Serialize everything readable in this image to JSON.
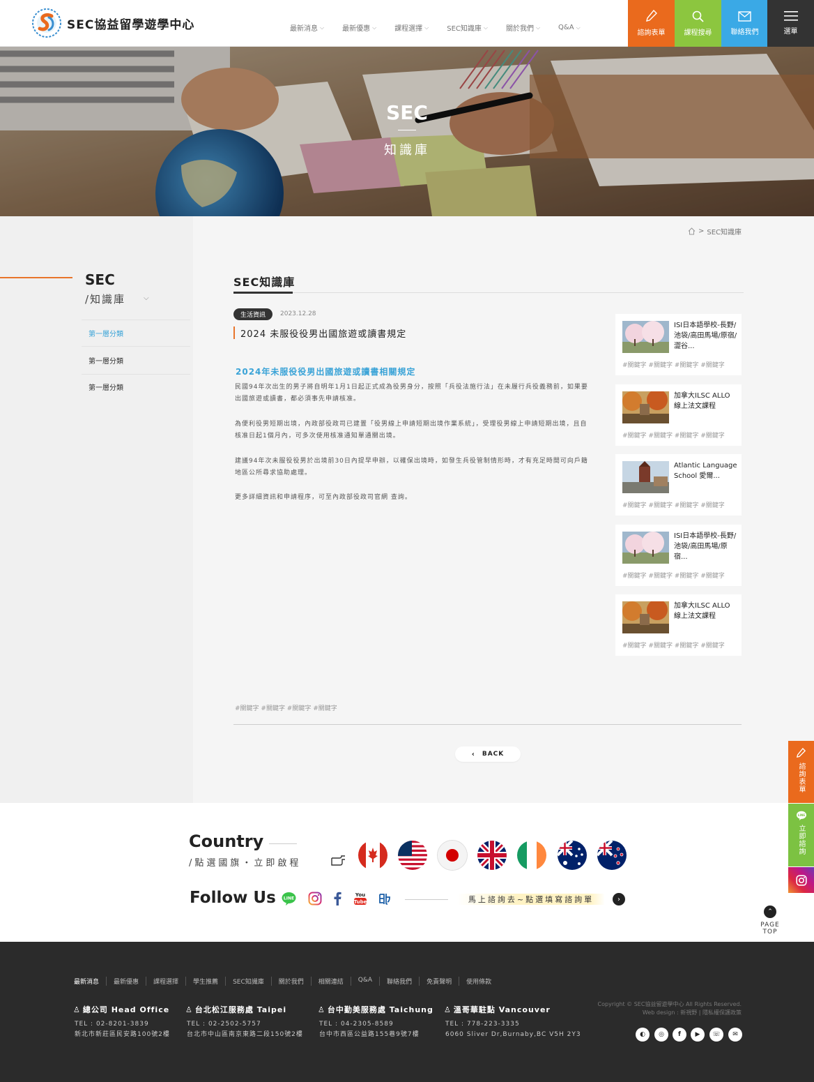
{
  "brand": {
    "name": "SEC協益留學遊學中心"
  },
  "nav": {
    "items": [
      {
        "label": "最新消息"
      },
      {
        "label": "最新優惠"
      },
      {
        "label": "課程選擇"
      },
      {
        "label": "SEC知識庫"
      },
      {
        "label": "關於我們"
      },
      {
        "label": "Q&A"
      }
    ]
  },
  "quick": {
    "inquiry": {
      "label": "諮詢表單",
      "color": "#ea6a1d",
      "icon": "pencil-icon"
    },
    "course": {
      "label": "課程搜尋",
      "color": "#8cc63f",
      "icon": "search-icon"
    },
    "contact": {
      "label": "聯絡我們",
      "color": "#3aa9e6",
      "icon": "mail-icon"
    },
    "menu": {
      "label": "選單",
      "color": "#333333",
      "icon": "hamburger-icon"
    }
  },
  "hero": {
    "title": "SEC",
    "subtitle": "知識庫"
  },
  "breadcrumb": {
    "home_icon": "home-icon",
    "current": "SEC知識庫"
  },
  "sidebar": {
    "title": "SEC",
    "subtitle": "/知識庫",
    "items": [
      {
        "label": "第一層分類"
      },
      {
        "label": "第一層分類"
      },
      {
        "label": "第一層分類"
      }
    ],
    "active_color": "#3aa3d7"
  },
  "article": {
    "section_title": "SEC知識庫",
    "tag": "生活資訊",
    "date": "2023.12.28",
    "title": "2024 未服役役男出國旅遊或讀書規定",
    "heading": "2024年未服役役男出國旅遊或讀書相關規定",
    "paragraphs": [
      "民國94年次出生的男子將自明年1月1日起正式成為役男身分，按照「兵役法施行法」在未履行兵役義務前，如果要出國旅遊或讀書，都必須事先申請核准。",
      "為便利役男短期出境，內政部役政司已建置「役男線上申請短期出境作業系統」，受理役男線上申請短期出境，且自核准日起1個月內，可多次使用核准通知單通關出境。",
      "建議94年次未服役役男於出境前30日內提早申辦，以確保出境時，如發生兵役管制情形時，才有充足時間可向戶籍地區公所尋求協助處理。",
      "更多詳細資訊和申請程序，可至內政部役政司官網 查詢。"
    ],
    "keywords": "#關鍵字 #關鍵字 #關鍵字 #關鍵字",
    "back_label": "BACK"
  },
  "related": [
    {
      "title": "ISI日本語學校-長野/池袋/高田馬場/原宿/澀谷...",
      "keywords": "#關鍵字 #關鍵字 #關鍵字 #關鍵字",
      "thumb": "cherry"
    },
    {
      "title": "加拿大ILSC ALLO 線上法文課程",
      "keywords": "#關鍵字 #關鍵字 #關鍵字 #關鍵字",
      "thumb": "autumn"
    },
    {
      "title": "Atlantic Language School 愛爾...",
      "keywords": "#關鍵字 #關鍵字 #關鍵字 #關鍵字",
      "thumb": "church"
    },
    {
      "title": "ISI日本語學校-長野/池袋/高田馬場/原宿...",
      "keywords": "#關鍵字 #關鍵字 #關鍵字 #關鍵字",
      "thumb": "cherry"
    },
    {
      "title": "加拿大ILSC ALLO 線上法文課程",
      "keywords": "#關鍵字 #關鍵字 #關鍵字 #關鍵字",
      "thumb": "autumn"
    }
  ],
  "country": {
    "title": "Country",
    "subtitle": "/點選國旗・立即啟程",
    "flags": [
      "canada-flag",
      "usa-flag",
      "japan-flag",
      "uk-flag",
      "ireland-flag",
      "australia-flag",
      "new-zealand-flag"
    ]
  },
  "follow": {
    "title": "Follow Us",
    "icons": [
      "line-icon",
      "instagram-icon",
      "facebook-icon",
      "youtube-icon",
      "weibo-icon"
    ],
    "cta": "馬上諮詢去~點選填寫諮詢單"
  },
  "floating": {
    "inquiry": "諮詢表單",
    "line": "立即諮詢",
    "pagetop": "PAGE TOP"
  },
  "footer": {
    "links": [
      "最新消息",
      "最新優惠",
      "課程選擇",
      "學生推薦",
      "SEC知識庫",
      "關於我們",
      "相關連結",
      "Q&A",
      "聯絡我們",
      "免責聲明",
      "使用條款"
    ],
    "offices": [
      {
        "name": "總公司 Head Office",
        "tel": "TEL : 02-8201-3839",
        "addr": "新北市新莊區民安路100號2樓"
      },
      {
        "name": "台北松江服務處 Taipei",
        "tel": "TEL : 02-2502-5757",
        "addr": "台北市中山區南京東路二段150號2樓"
      },
      {
        "name": "台中勤美服務處 Taichung",
        "tel": "TEL : 04-2305-8589",
        "addr": "台中市西區公益路155巷9號7樓"
      },
      {
        "name": "溫哥華駐點 Vancouver",
        "tel": "TEL : 778-223-3335",
        "addr": "6060 Sliver Dr,Burnaby,BC V5H 2Y3"
      }
    ],
    "copyright": "Copyright © SEC協益留遊學中心 All Rights Reserved.",
    "credit": "Web design : 新視野 | 隱私權保護政策",
    "icons": [
      "line-icon",
      "instagram-icon",
      "facebook-icon",
      "youtube-icon",
      "phone-icon",
      "mail-icon"
    ]
  }
}
